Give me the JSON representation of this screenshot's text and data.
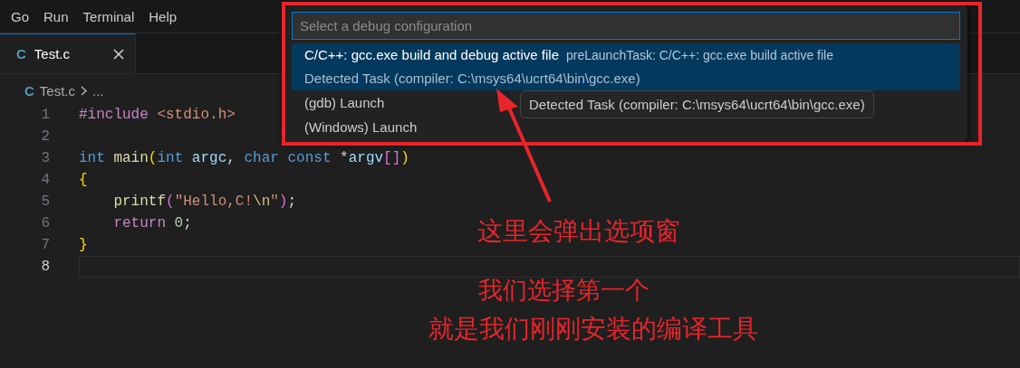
{
  "menu": [
    {
      "label": "Go"
    },
    {
      "label": "Run"
    },
    {
      "label": "Terminal"
    },
    {
      "label": "Help"
    }
  ],
  "tabs": [
    {
      "icon": "C",
      "label": "Test.c",
      "selected": true
    }
  ],
  "breadcrumb": {
    "icon": "C",
    "file": "Test.c",
    "rest": "..."
  },
  "editor": {
    "lines": [
      {
        "number": "1",
        "current": false,
        "tokens": [
          {
            "kind": "kw",
            "text": "#include"
          },
          {
            "kind": "str",
            "text": " <stdio.h>"
          }
        ]
      },
      {
        "number": "2",
        "current": false
      },
      {
        "number": "3",
        "current": false,
        "tokens": [
          {
            "kind": "type",
            "text": "int"
          },
          {
            "kind": "fn",
            "text": " main"
          },
          {
            "kind": "brace1",
            "text": "("
          },
          {
            "kind": "type",
            "text": "int"
          },
          {
            "kind": "var",
            "text": " argc"
          },
          {
            "kind": "plain",
            "text": ","
          },
          {
            "kind": "type",
            "text": " char const"
          },
          {
            "kind": "plain",
            "text": " *"
          },
          {
            "kind": "var",
            "text": "argv"
          },
          {
            "kind": "brace2",
            "text": "[]"
          },
          {
            "kind": "brace1",
            "text": ")"
          }
        ]
      },
      {
        "number": "4",
        "current": false,
        "tokens": [
          {
            "kind": "brace1",
            "text": "{"
          }
        ]
      },
      {
        "number": "5",
        "current": false,
        "tokens": [
          {
            "kind": "fn",
            "text": "    printf"
          },
          {
            "kind": "brace2",
            "text": "("
          },
          {
            "kind": "str",
            "text": "\"Hello,C!"
          },
          {
            "kind": "esc",
            "text": "\\n"
          },
          {
            "kind": "str",
            "text": "\""
          },
          {
            "kind": "brace2",
            "text": ")"
          },
          {
            "kind": "plain",
            "text": ";"
          }
        ]
      },
      {
        "number": "6",
        "current": false,
        "tokens": [
          {
            "kind": "kw",
            "text": "    return"
          },
          {
            "kind": "num",
            "text": " 0"
          },
          {
            "kind": "plain",
            "text": ";"
          }
        ]
      },
      {
        "number": "7",
        "current": false,
        "tokens": [
          {
            "kind": "brace1",
            "text": "}"
          }
        ]
      },
      {
        "number": "8",
        "current": true
      }
    ]
  },
  "quick_pick": {
    "placeholder": "Select a debug configuration",
    "items": [
      {
        "label": "C/C++: gcc.exe build and debug active file",
        "description": "preLaunchTask: C/C++: gcc.exe build active file",
        "detail": "Detected Task (compiler: C:\\msys64\\ucrt64\\bin\\gcc.exe)",
        "selected": true
      },
      {
        "label": "(gdb) Launch",
        "selected": false
      },
      {
        "label": "(Windows) Launch",
        "selected": false
      }
    ],
    "tooltip": "Detected Task (compiler: C:\\msys64\\ucrt64\\bin\\gcc.exe)"
  },
  "annotations": [
    {
      "text": "这里会弹出选项窗"
    },
    {
      "text": "我们选择第一个"
    },
    {
      "text": "就是我们刚刚安装的编译工具"
    }
  ]
}
